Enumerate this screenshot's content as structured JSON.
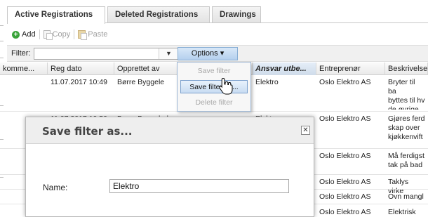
{
  "tabs": [
    {
      "label": "Active Registrations",
      "active": true
    },
    {
      "label": "Deleted Registrations",
      "active": false
    },
    {
      "label": "Drawings",
      "active": false
    }
  ],
  "toolbar": {
    "add_label": "Add",
    "copy_label": "Copy",
    "paste_label": "Paste"
  },
  "filter": {
    "label": "Filter:",
    "value": "",
    "options_label": "Options ▾"
  },
  "grid": {
    "columns": [
      "komme...",
      "Reg dato",
      "Opprettet av",
      "",
      "Ansvar utbe...",
      "Entreprenør",
      "Beskrivelse"
    ],
    "rows": [
      [
        "",
        "11.07.2017 10:49",
        "Børre Byggele",
        "",
        "Elektro",
        "Oslo Elektro AS",
        "Bryter til ba\nbyttes til hv\nde øvrige"
      ],
      [
        "",
        "11.07.2017 10:50",
        "Børre Byggeleder",
        "",
        "Elektro",
        "Oslo Elektro AS",
        "Gjøres ferd\nskap over\nkjøkkenvift"
      ],
      [
        "",
        "",
        "",
        "",
        "",
        "Oslo Elektro AS",
        "Må ferdigst\ntak på bad"
      ],
      [
        "",
        "",
        "",
        "",
        "",
        "Oslo Elektro AS",
        "Taklys virke"
      ],
      [
        "",
        "",
        "",
        "",
        "",
        "Oslo Elektro AS",
        "Ovn mangl"
      ],
      [
        "",
        "",
        "",
        "",
        "",
        "Oslo Elektro AS",
        "Elektrisk ov"
      ]
    ]
  },
  "options_menu": {
    "items": [
      {
        "label": "Save filter",
        "enabled": false
      },
      {
        "label": "Save filter as...",
        "enabled": true
      },
      {
        "label": "Delete filter",
        "enabled": false
      }
    ]
  },
  "dialog": {
    "title": "Save filter as...",
    "close_glyph": "✕",
    "name_label": "Name:",
    "name_value": "Elektro"
  },
  "colors": {
    "accent": "#b5d0ee",
    "add_icon": "#3aa33a"
  }
}
